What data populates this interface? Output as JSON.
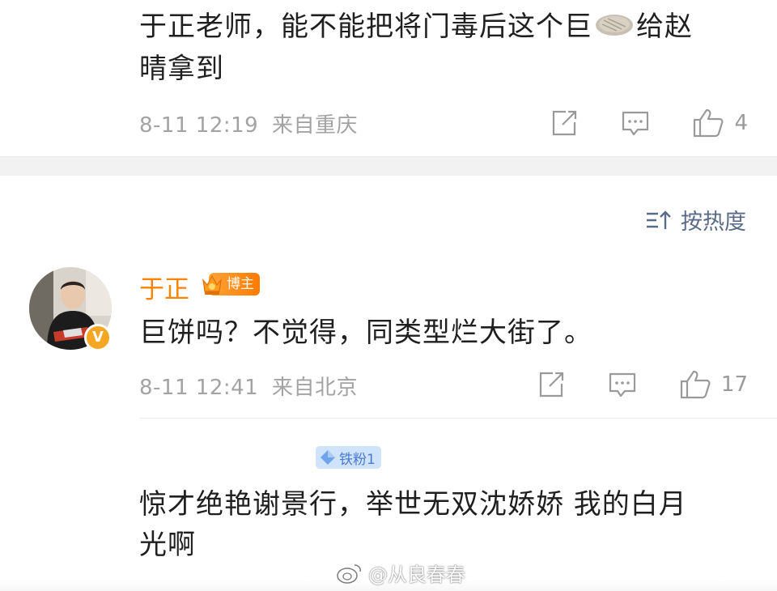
{
  "top_comment": {
    "text_line1": "于正老师，能不能把将门毒后这个巨",
    "text_line1_end": "给赵",
    "text_line2": "晴拿到",
    "emoji_name": "pancake-emoji",
    "time": "8-11 12:19",
    "location": "来自重庆",
    "likes": "4"
  },
  "sort": {
    "label": "按热度",
    "icon": "sort-icon"
  },
  "host_comment": {
    "username": "于正",
    "badge": "博主",
    "text": "巨饼吗？不觉得，同类型烂大街了。",
    "time": "8-11 12:41",
    "location": "来自北京",
    "likes": "17"
  },
  "fan_comment": {
    "fan_badge": "铁粉1",
    "text_line1": "惊才绝艳谢景行，举世无双沈娇娇 我的白月",
    "text_line2": "光啊"
  },
  "watermark": {
    "text": "@从良春春"
  },
  "colors": {
    "username": "#ff8200",
    "meta": "#a3a3a3",
    "sort": "#5a6b87",
    "fan_badge_bg": "#cfe3fb"
  }
}
